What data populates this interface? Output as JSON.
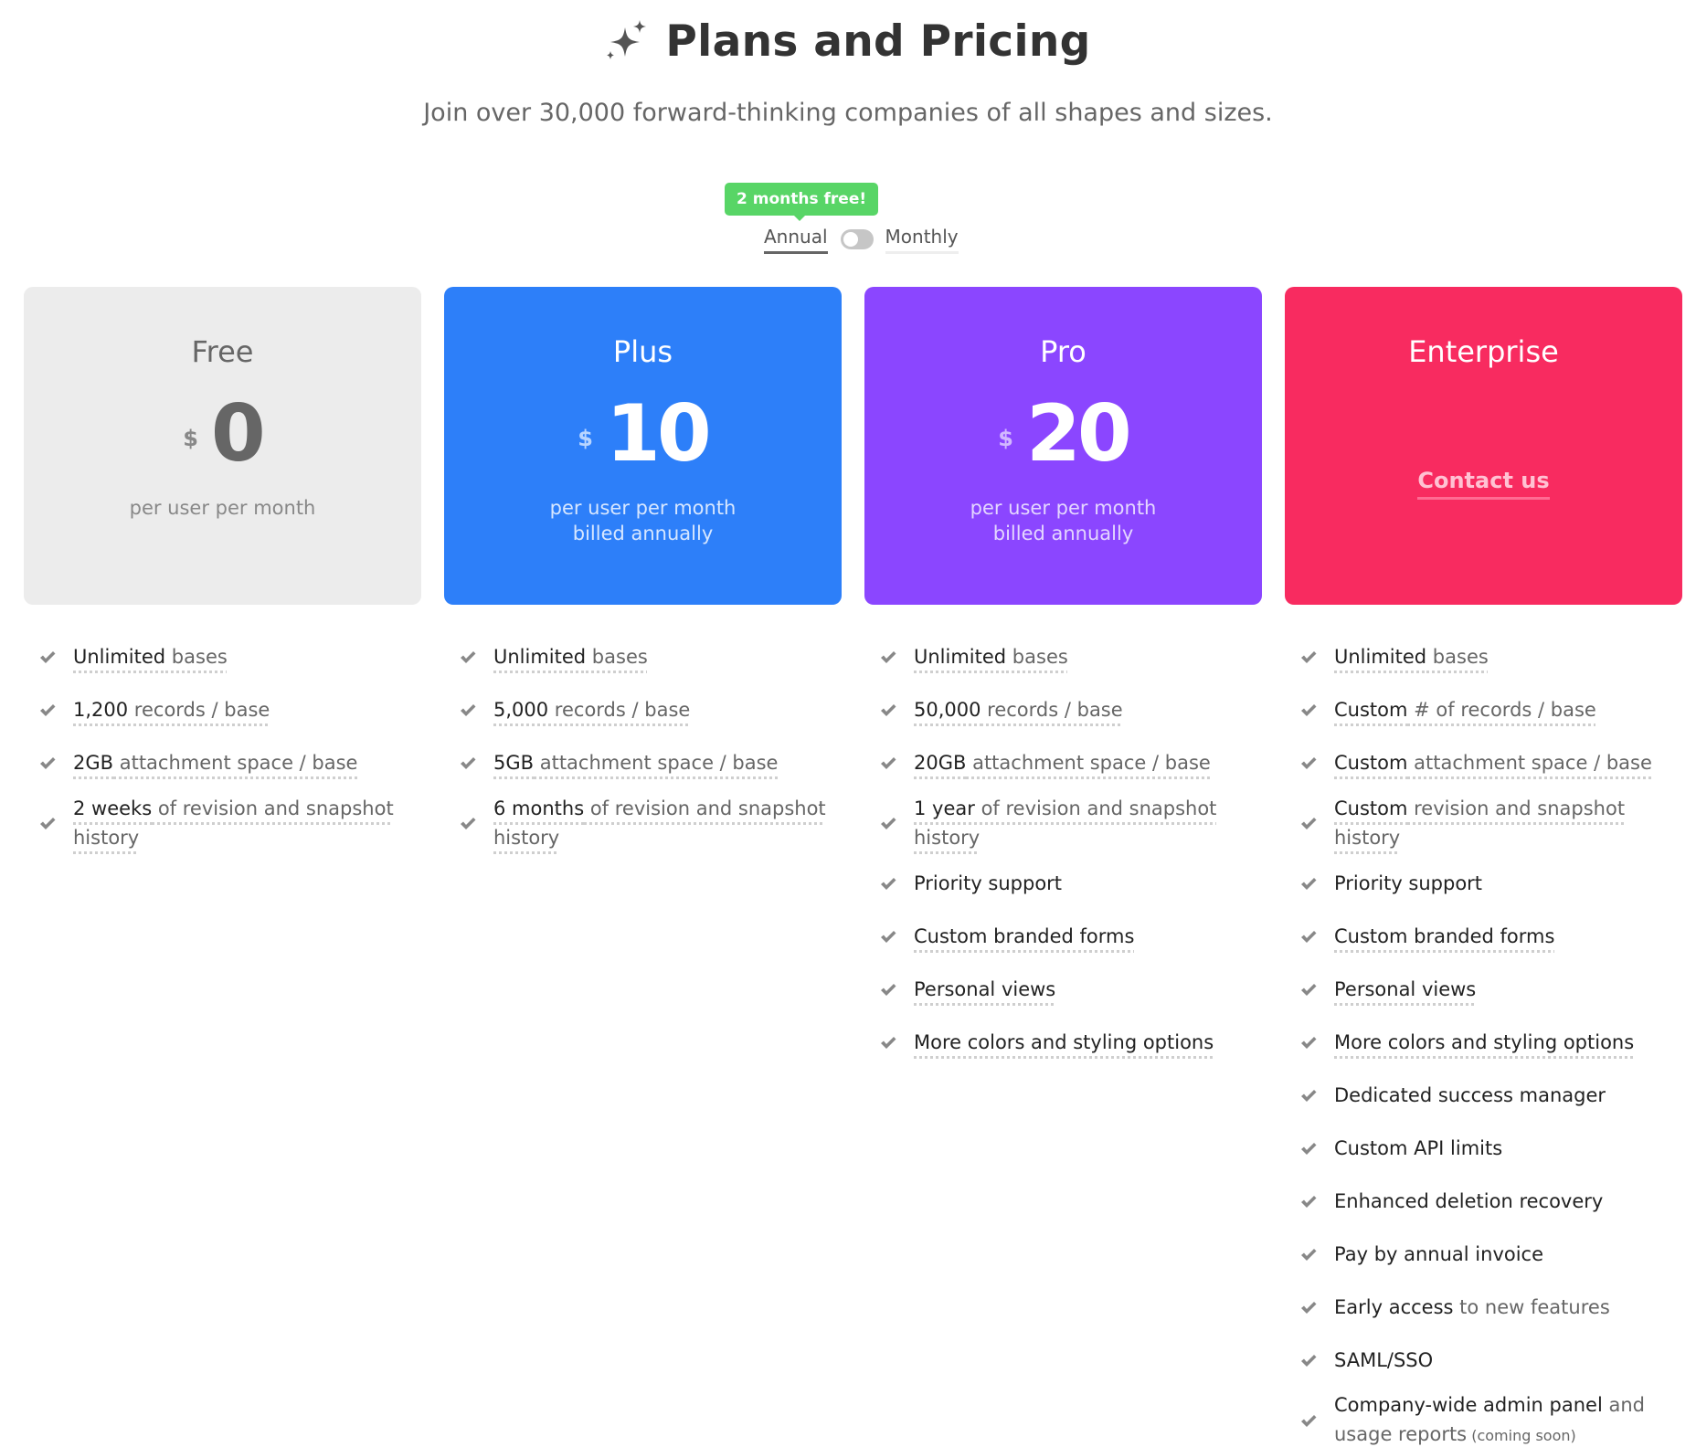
{
  "header": {
    "icon": "sparkles-icon",
    "title": "Plans and Pricing",
    "subtitle": "Join over 30,000 forward-thinking companies of all shapes and sizes."
  },
  "billing": {
    "badge": "2 months free!",
    "annual_label": "Annual",
    "monthly_label": "Monthly",
    "selected": "Annual"
  },
  "colors": {
    "free": "#ececec",
    "plus": "#2d7ff9",
    "pro": "#8b46ff",
    "enterprise": "#f82b60",
    "badge": "#58d566"
  },
  "plans": [
    {
      "name": "Free",
      "currency": "$",
      "price": "0",
      "note_line1": "per user per month",
      "note_line2": "",
      "features": [
        {
          "strong": "Unlimited",
          "rest": " bases",
          "dotted": true
        },
        {
          "strong": "1,200",
          "rest": " records / base",
          "dotted": true
        },
        {
          "strong": "2GB",
          "rest": " attachment space / base",
          "dotted": true
        },
        {
          "strong": "2 weeks",
          "rest": " of revision and snapshot history",
          "dotted": true
        }
      ]
    },
    {
      "name": "Plus",
      "currency": "$",
      "price": "10",
      "note_line1": "per user per month",
      "note_line2": "billed annually",
      "features": [
        {
          "strong": "Unlimited",
          "rest": " bases",
          "dotted": true
        },
        {
          "strong": "5,000",
          "rest": " records / base",
          "dotted": true
        },
        {
          "strong": "5GB",
          "rest": " attachment space / base",
          "dotted": true
        },
        {
          "strong": "6 months",
          "rest": " of revision and snapshot history",
          "dotted": true
        }
      ]
    },
    {
      "name": "Pro",
      "currency": "$",
      "price": "20",
      "note_line1": "per user per month",
      "note_line2": "billed annually",
      "features": [
        {
          "strong": "Unlimited",
          "rest": " bases",
          "dotted": true
        },
        {
          "strong": "50,000",
          "rest": " records / base",
          "dotted": true
        },
        {
          "strong": "20GB",
          "rest": " attachment space / base",
          "dotted": true
        },
        {
          "strong": "1 year",
          "rest": " of revision and snapshot history",
          "dotted": true
        },
        {
          "strong": "Priority support",
          "rest": "",
          "dotted": false
        },
        {
          "strong": "Custom branded forms",
          "rest": "",
          "dotted": true
        },
        {
          "strong": "Personal views",
          "rest": "",
          "dotted": true
        },
        {
          "strong": "More colors and styling options",
          "rest": "",
          "dotted": true
        }
      ]
    },
    {
      "name": "Enterprise",
      "cta": "Contact us",
      "features": [
        {
          "strong": "Unlimited",
          "rest": " bases",
          "dotted": true
        },
        {
          "strong": "Custom",
          "rest": " # of records / base",
          "dotted": true
        },
        {
          "strong": "Custom",
          "rest": " attachment space / base",
          "dotted": true
        },
        {
          "strong": "Custom",
          "rest": " revision and snapshot history",
          "dotted": true
        },
        {
          "strong": "Priority support",
          "rest": "",
          "dotted": false
        },
        {
          "strong": "Custom branded forms",
          "rest": "",
          "dotted": true
        },
        {
          "strong": "Personal views",
          "rest": "",
          "dotted": true
        },
        {
          "strong": "More colors and styling options",
          "rest": "",
          "dotted": true
        },
        {
          "strong": "Dedicated success manager",
          "rest": "",
          "dotted": false
        },
        {
          "strong": "Custom API limits",
          "rest": "",
          "dotted": false
        },
        {
          "strong": "Enhanced deletion recovery",
          "rest": "",
          "dotted": false
        },
        {
          "strong": "Pay by annual invoice",
          "rest": "",
          "dotted": false
        },
        {
          "strong": "Early access",
          "rest": " to new features",
          "dotted": false
        },
        {
          "strong": "SAML/SSO",
          "rest": "",
          "dotted": false
        },
        {
          "strong": "Company-wide admin panel",
          "rest": " and usage reports",
          "small": " (coming soon)",
          "dotted": false
        }
      ]
    }
  ]
}
